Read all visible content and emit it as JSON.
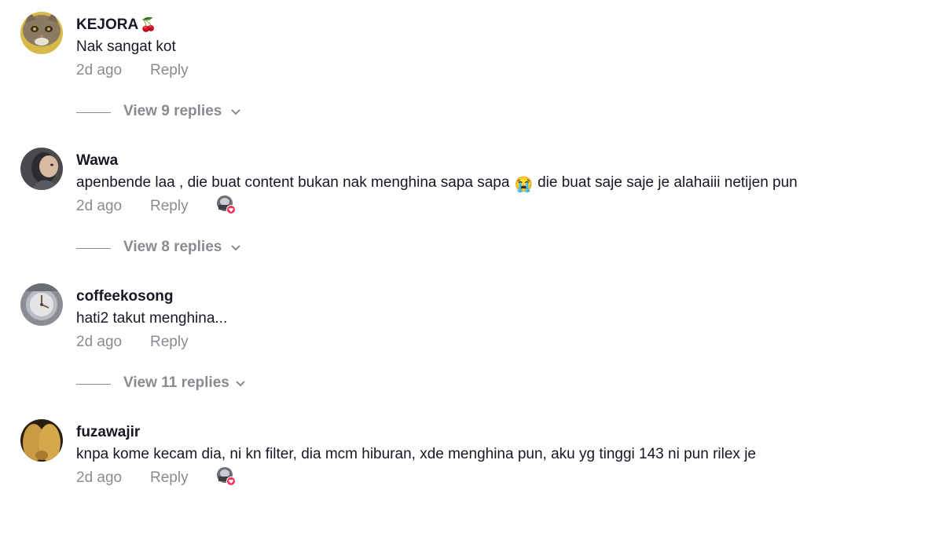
{
  "comments": [
    {
      "username": "KEJORA",
      "username_emoji": "🍒",
      "text_before": "Nak sangat kot",
      "text_emoji": "",
      "text_after": "",
      "time": "2d ago",
      "reply_label": "Reply",
      "liked_by_creator": false,
      "view_replies": "View 9 replies",
      "avatar": "cat-photo"
    },
    {
      "username": "Wawa",
      "username_emoji": "",
      "text_before": "apenbende laa , die buat content bukan nak menghina sapa sapa",
      "text_emoji": "😭",
      "text_after": "die buat saje saje je alahaiii netijen pun",
      "time": "2d ago",
      "reply_label": "Reply",
      "liked_by_creator": true,
      "view_replies": "View 8 replies",
      "avatar": "hijab-person-photo"
    },
    {
      "username": "coffeekosong",
      "username_emoji": "",
      "text_before": "hati2 takut menghina...",
      "text_emoji": "",
      "text_after": "",
      "time": "2d ago",
      "reply_label": "Reply",
      "liked_by_creator": false,
      "view_replies": "View 11 replies",
      "avatar": "watch-photo"
    },
    {
      "username": "fuzawajir",
      "username_emoji": "",
      "text_before": "knpa kome kecam dia, ni kn filter, dia mcm hiburan, xde menghina pun, aku yg tinggi 143 ni pun rilex je",
      "text_emoji": "",
      "text_after": "",
      "time": "2d ago",
      "reply_label": "Reply",
      "liked_by_creator": true,
      "view_replies": "",
      "avatar": "gold-shape-photo"
    }
  ],
  "icons": {
    "chevron": "chevron-down-icon",
    "liked_badge": "creator-liked-icon"
  },
  "colors": {
    "text": "#161823",
    "secondary": "#8a8b91",
    "heart": "#fe2c55"
  }
}
